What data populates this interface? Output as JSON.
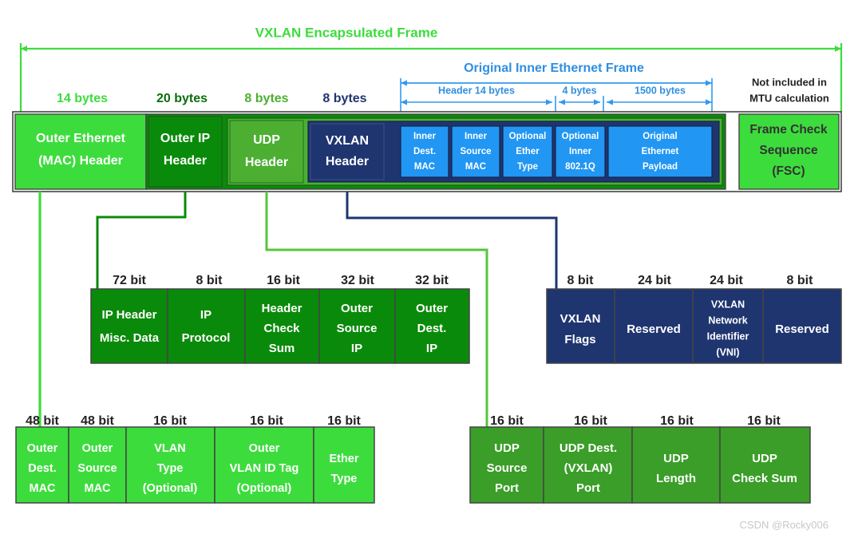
{
  "colors": {
    "bright_green": "#3ddc3d",
    "dark_green": "#0a8a0a",
    "mid_green": "#4caf32",
    "navy": "#1f3570",
    "inner_blue": "#2196f3",
    "arrow_blue": "#3399ee",
    "block_stroke": "#444444",
    "white": "#ffffff",
    "text_dark": "#222222",
    "watermark_gray": "#c8c8c8"
  },
  "top_span": {
    "label": "VXLAN Encapsulated Frame",
    "color": "#3ddc3d"
  },
  "inner_span": {
    "label": "Original Inner Ethernet Frame",
    "color": "#3399ee",
    "sub_spans": [
      {
        "label": "Header 14 bytes"
      },
      {
        "label": "4 bytes"
      },
      {
        "label": "1500 bytes"
      }
    ]
  },
  "mtu_note": {
    "line1": "Not included in",
    "line2": "MTU calculation"
  },
  "main_row": {
    "size_labels": [
      {
        "text": "14 bytes",
        "color": "#3ddc3d"
      },
      {
        "text": "20 bytes",
        "color": "#0a6e0a"
      },
      {
        "text": "8 bytes",
        "color": "#4caf32"
      },
      {
        "text": "8 bytes",
        "color": "#1f3570"
      }
    ],
    "blocks": [
      {
        "lines": [
          "Outer Ethernet",
          "(MAC) Header"
        ],
        "fill": "#3ddc3d",
        "text": "#ffffff"
      },
      {
        "lines": [
          "Outer IP",
          "Header"
        ],
        "fill": "#0a8a0a",
        "text": "#ffffff"
      },
      {
        "lines": [
          "UDP",
          "Header"
        ],
        "fill": "#4caf32",
        "text": "#ffffff"
      },
      {
        "lines": [
          "VXLAN",
          "Header"
        ],
        "fill": "#1f3570",
        "text": "#ffffff"
      }
    ],
    "inner_blocks": [
      {
        "lines": [
          "Inner",
          "Dest.",
          "MAC"
        ],
        "fill": "#2196f3",
        "text": "#ffffff"
      },
      {
        "lines": [
          "Inner",
          "Source",
          "MAC"
        ],
        "fill": "#2196f3",
        "text": "#ffffff"
      },
      {
        "lines": [
          "Optional",
          "Ether",
          "Type"
        ],
        "fill": "#2196f3",
        "text": "#ffffff"
      },
      {
        "lines": [
          "Optional",
          "Inner",
          "802.1Q"
        ],
        "fill": "#2196f3",
        "text": "#ffffff"
      },
      {
        "lines": [
          "Original",
          "Ethernet",
          "Payload"
        ],
        "fill": "#2196f3",
        "text": "#ffffff"
      }
    ],
    "fcs_block": {
      "lines": [
        "Frame Check",
        "Sequence",
        "(FSC)"
      ],
      "fill": "#3ddc3d",
      "text": "#333333"
    }
  },
  "ip_detail_row": {
    "size_labels": [
      "72 bit",
      "8 bit",
      "16 bit",
      "32 bit",
      "32 bit"
    ],
    "blocks": [
      {
        "lines": [
          "IP Header",
          "Misc. Data"
        ]
      },
      {
        "lines": [
          "IP",
          "Protocol"
        ]
      },
      {
        "lines": [
          "Header",
          "Check",
          "Sum"
        ]
      },
      {
        "lines": [
          "Outer",
          "Source",
          "IP"
        ]
      },
      {
        "lines": [
          "Outer",
          "Dest.",
          "IP"
        ]
      }
    ],
    "fill": "#0a8a0a",
    "text": "#ffffff"
  },
  "vxlan_detail_row": {
    "size_labels": [
      "8 bit",
      "24 bit",
      "24 bit",
      "8 bit"
    ],
    "blocks": [
      {
        "lines": [
          "VXLAN",
          "Flags"
        ]
      },
      {
        "lines": [
          "Reserved"
        ]
      },
      {
        "lines": [
          "VXLAN",
          "Network",
          "Identifier",
          "(VNI)"
        ]
      },
      {
        "lines": [
          "Reserved"
        ]
      }
    ],
    "fill": "#1f3570",
    "text": "#ffffff"
  },
  "mac_detail_row": {
    "size_labels": [
      "48 bit",
      "48 bit",
      "16 bit",
      "16 bit",
      "16 bit"
    ],
    "blocks": [
      {
        "lines": [
          "Outer",
          "Dest.",
          "MAC"
        ]
      },
      {
        "lines": [
          "Outer",
          "Source",
          "MAC"
        ]
      },
      {
        "lines": [
          "VLAN",
          "Type",
          "(Optional)"
        ]
      },
      {
        "lines": [
          "Outer",
          "VLAN ID Tag",
          "(Optional)"
        ]
      },
      {
        "lines": [
          "Ether",
          "Type"
        ]
      }
    ],
    "fill": "#3ddc3d",
    "text": "#ffffff"
  },
  "udp_detail_row": {
    "size_labels": [
      "16 bit",
      "16 bit",
      "16 bit",
      "16 bit"
    ],
    "blocks": [
      {
        "lines": [
          "UDP",
          "Source",
          "Port"
        ]
      },
      {
        "lines": [
          "UDP Dest.",
          "(VXLAN)",
          "Port"
        ]
      },
      {
        "lines": [
          "UDP",
          "Length"
        ]
      },
      {
        "lines": [
          "UDP",
          "Check Sum"
        ]
      }
    ],
    "fill": "#3a9e28",
    "text": "#ffffff"
  },
  "watermark": {
    "text": "CSDN @Rocky006"
  }
}
